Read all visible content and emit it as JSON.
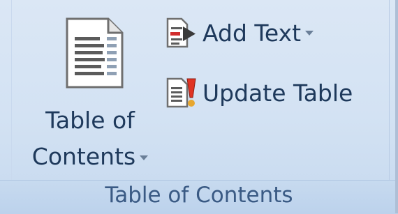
{
  "ribbon_group": {
    "label": "Table of Contents",
    "table_of_contents_button": {
      "line1": "Table of",
      "line2": "Contents"
    },
    "add_text_button": {
      "label": "Add Text"
    },
    "update_table_button": {
      "label": "Update Table"
    }
  },
  "icons": {
    "table_of_contents": "document-toc-icon",
    "add_text": "add-text-icon",
    "update_table": "update-table-icon",
    "dropdown": "chevron-down-icon"
  },
  "colors": {
    "ribbon_bg": "#d3e2f3",
    "label_text": "#1e395b",
    "group_label_text": "#3a5a84"
  }
}
